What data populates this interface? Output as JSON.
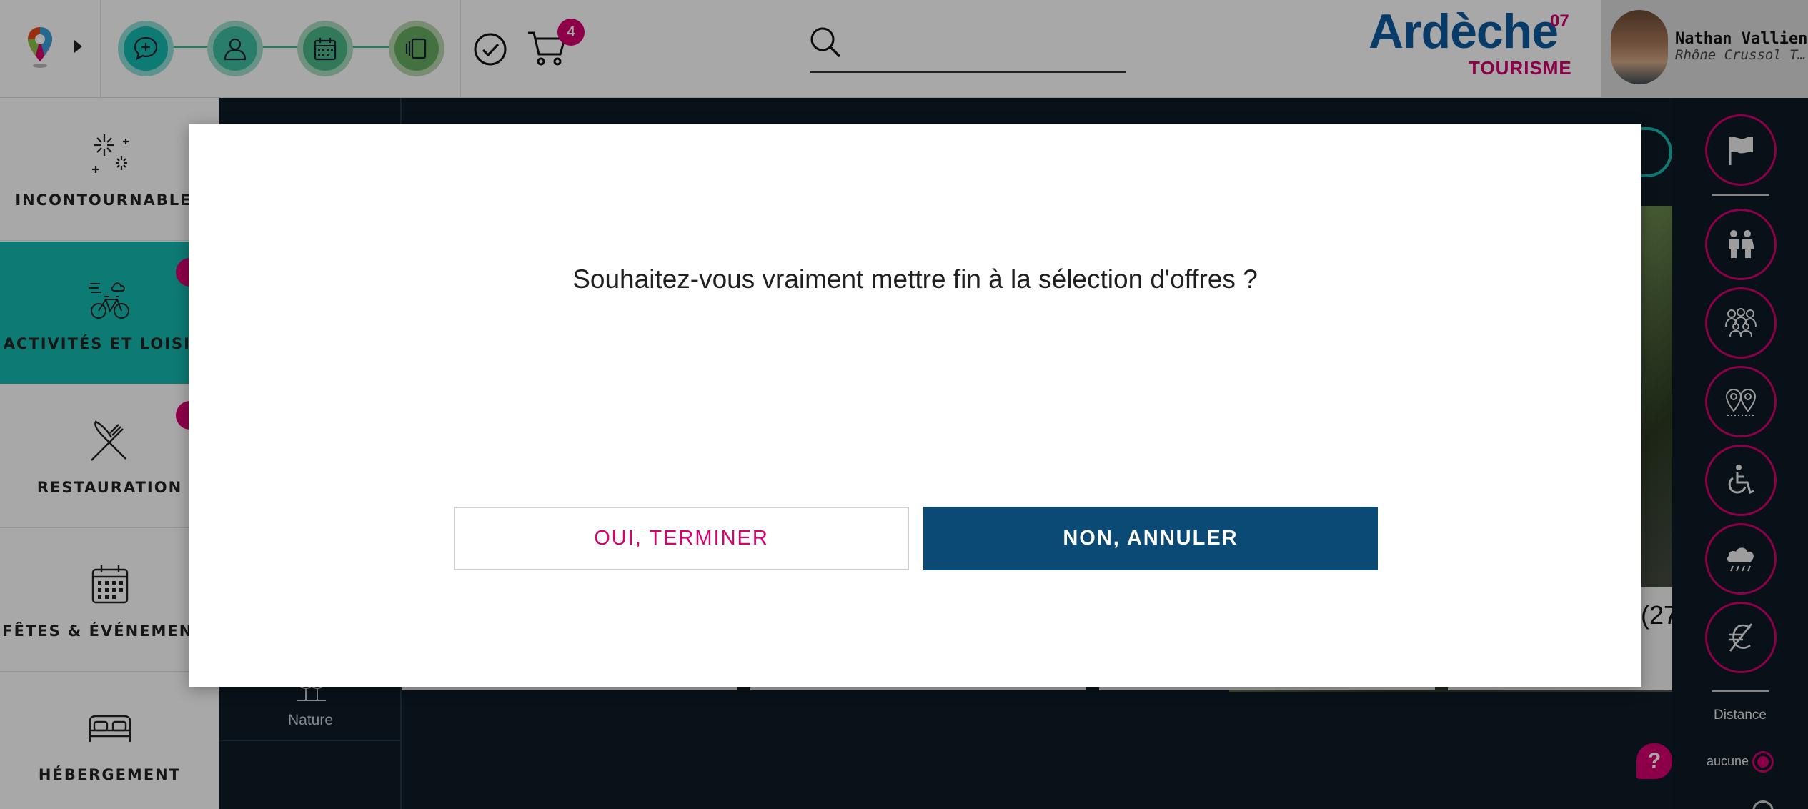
{
  "header": {
    "steps": [
      {
        "icon": "chat-plus-icon"
      },
      {
        "icon": "user-icon"
      },
      {
        "icon": "calendar-icon"
      },
      {
        "icon": "cards-icon"
      }
    ],
    "cart_count": "4",
    "search": {
      "value": "",
      "placeholder": ""
    },
    "brand": {
      "name": "Ardèche",
      "number": "07",
      "subtitle": "TOURISME"
    },
    "user": {
      "name": "Nathan Vallienne",
      "organization": "Rhône Crussol Tourisme"
    }
  },
  "sidebar": {
    "items": [
      {
        "label": "INCONTOURNABLES",
        "icon": "fireworks-icon"
      },
      {
        "label": "ACTIVITÉS ET LOISIRS",
        "icon": "bike-weather-icon",
        "active": true
      },
      {
        "label": "RESTAURATION",
        "icon": "fork-knife-icon"
      },
      {
        "label": "FÊTES & ÉVÉNEMENTS",
        "icon": "calendar-icon"
      },
      {
        "label": "HÉBERGEMENT",
        "icon": "bed-icon"
      }
    ]
  },
  "subcategories": {
    "nature_label": "Nature"
  },
  "results": {
    "partial_count": "(27"
  },
  "filters": {
    "buttons": [
      "flag-icon",
      "family-icon",
      "group-icon",
      "map-pins-icon",
      "wheelchair-icon",
      "rain-cloud-icon",
      "euro-crossed-icon"
    ],
    "distance_label": "Distance",
    "distance_option": "aucune"
  },
  "help_label": "?",
  "modal": {
    "question": "Souhaitez-vous vraiment mettre fin à la sélection d'offres ?",
    "confirm_label": "OUI, TERMINER",
    "cancel_label": "NON, ANNULER"
  },
  "colors": {
    "accent_pink": "#d6006f",
    "teal": "#16b9b0",
    "navy_button": "#0b4a75",
    "brand_blue": "#0f5aa0",
    "step_green": "#3fb88f"
  }
}
